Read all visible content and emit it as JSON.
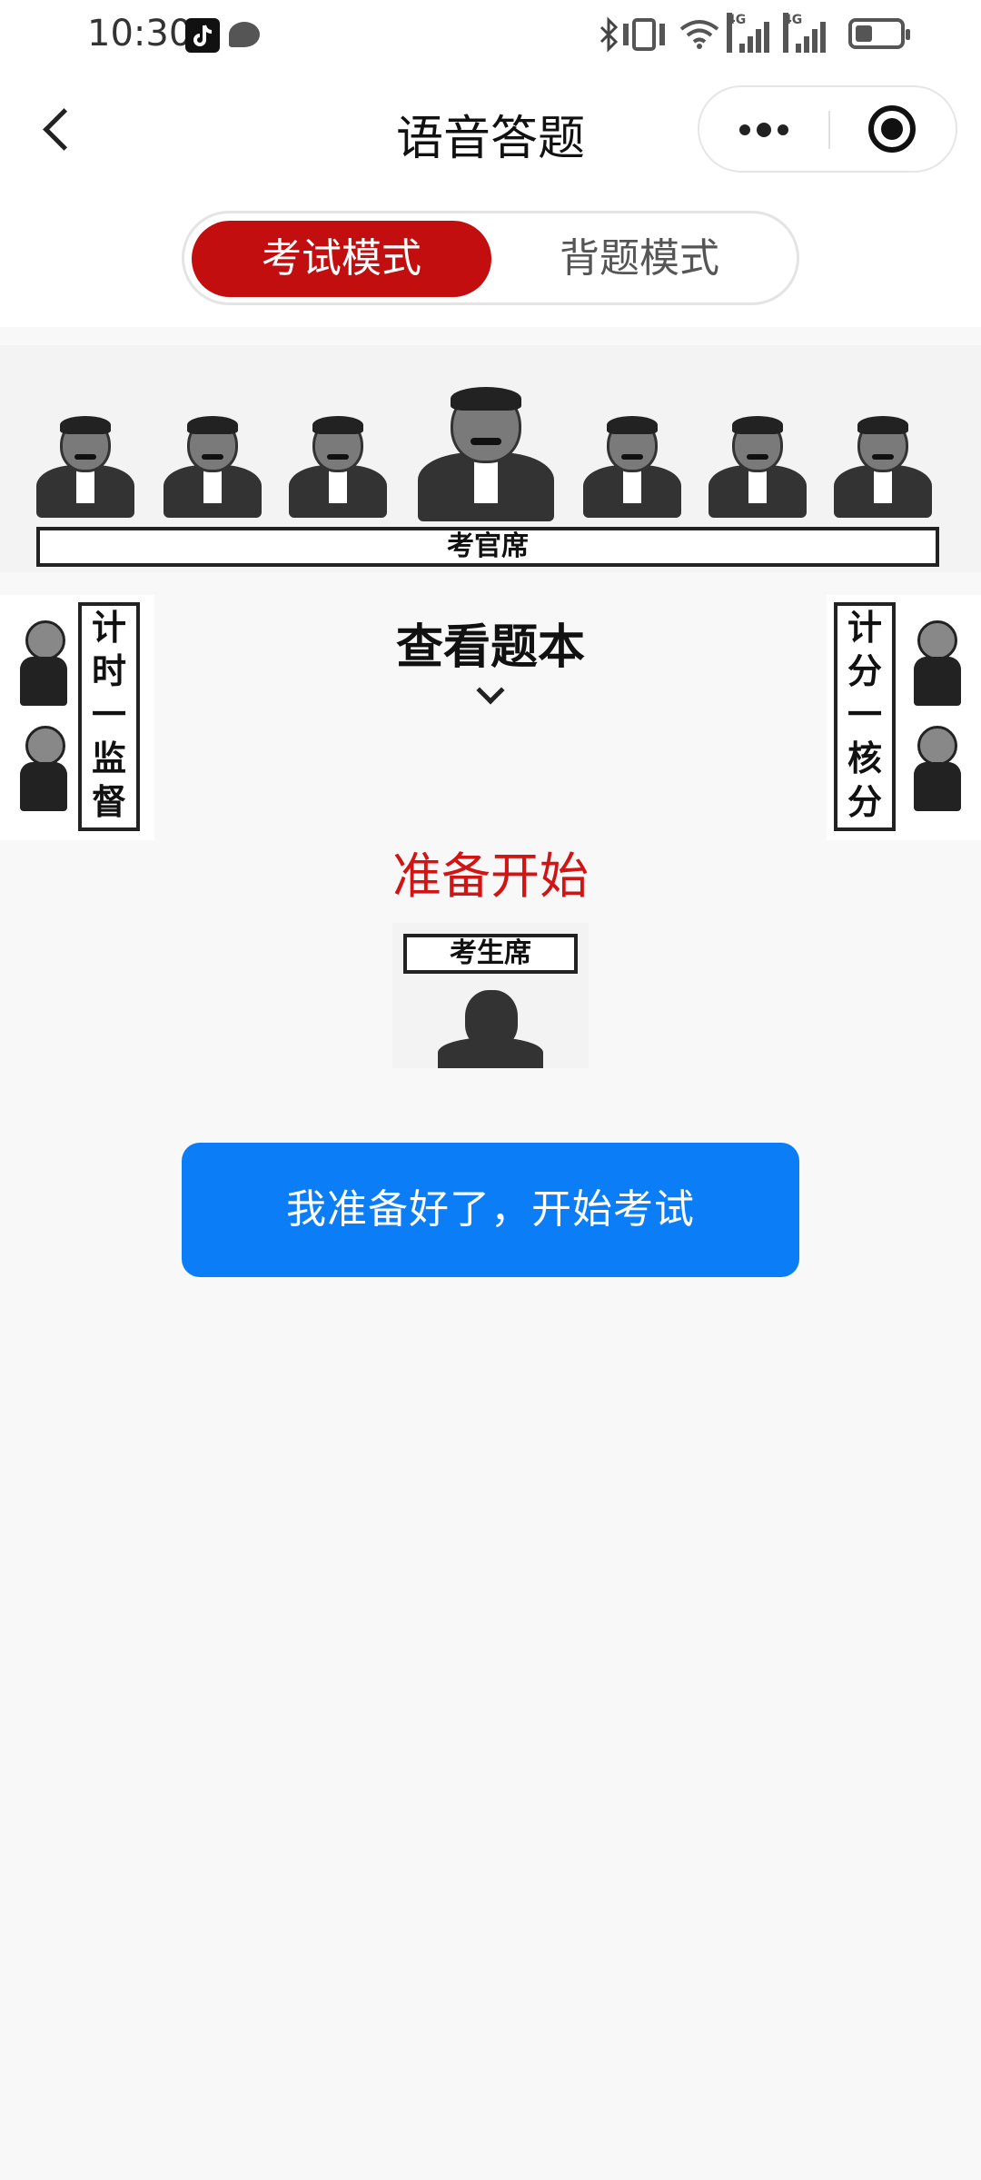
{
  "status_bar": {
    "time": "10:30",
    "icons": [
      "tiktok-icon",
      "chat-bubble-icon",
      "bluetooth-icon",
      "vibrate-icon",
      "wifi-icon",
      "signal-4g-icon",
      "signal-4g-icon",
      "battery-icon"
    ],
    "network_1": "4G",
    "network_2": "4G",
    "battery_level": 0.4
  },
  "nav": {
    "title": "语音答题",
    "back_icon": "chevron-left-icon",
    "more_icon": "more-dots-icon",
    "close_icon": "target-close-icon"
  },
  "mode_switch": {
    "tabs": [
      {
        "label": "考试模式",
        "active": true
      },
      {
        "label": "背题模式",
        "active": false
      }
    ],
    "active_color": "#c20e0e"
  },
  "illustration": {
    "examiner_table_label": "考官席",
    "left_sign": [
      "计",
      "时",
      "一",
      "监",
      "督"
    ],
    "right_sign": [
      "计",
      "分",
      "一",
      "核",
      "分"
    ],
    "candidate_sign_label": "考生席"
  },
  "view_text": {
    "label": "查看题本",
    "icon": "chevron-down-icon"
  },
  "status_text": {
    "label": "准备开始",
    "color": "#d11414"
  },
  "start_button": {
    "label": "我准备好了，开始考试",
    "color": "#0a7df7"
  }
}
